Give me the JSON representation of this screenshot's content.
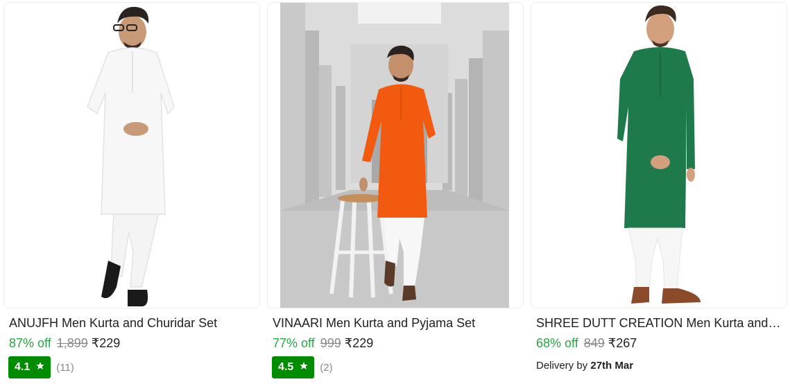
{
  "products": [
    {
      "title": "ANUJFH Men Kurta and Churidar Set",
      "discount": "87% off",
      "mrp": "1,899",
      "price": "₹229",
      "rating": "4.1",
      "rating_count": "(11)",
      "image_icon": "product-photo-white-kurta",
      "kurta_color": "#f7f7f7"
    },
    {
      "title": "VINAARI Men Kurta and Pyjama Set",
      "discount": "77% off",
      "mrp": "999",
      "price": "₹229",
      "rating": "4.5",
      "rating_count": "(2)",
      "image_icon": "product-photo-orange-kurta",
      "kurta_color": "#f25a0f"
    },
    {
      "title": "SHREE DUTT CREATION Men Kurta and Pyjama Set",
      "discount": "68% off",
      "mrp": "849",
      "price": "₹267",
      "delivery_prefix": "Delivery by",
      "delivery_date": "27th Mar",
      "image_icon": "product-photo-green-kurta",
      "kurta_color": "#1e7a4a"
    }
  ],
  "colors": {
    "discount": "#26a541",
    "rating_badge": "#008c00",
    "muted": "#878787",
    "text": "#212121"
  }
}
